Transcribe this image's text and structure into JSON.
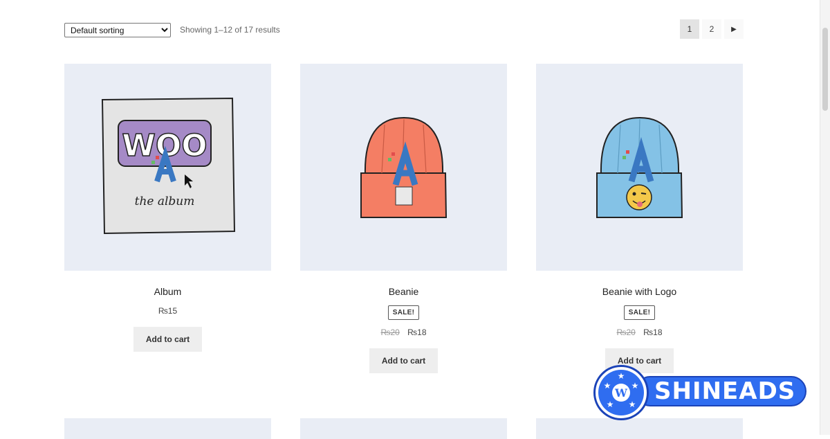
{
  "toolbar": {
    "sort_value": "Default sorting",
    "result_count": "Showing 1–12 of 17 results"
  },
  "pagination": {
    "pages": [
      "1",
      "2"
    ],
    "current": "1",
    "next_icon": "triangle-right-icon"
  },
  "products": [
    {
      "title": "Album",
      "sale_badge": "",
      "old_price": "",
      "price": "₨15",
      "button": "Add to cart",
      "image": "woo-album-art"
    },
    {
      "title": "Beanie",
      "sale_badge": "SALE!",
      "old_price": "₨20",
      "price": "₨18",
      "button": "Add to cart",
      "image": "orange-beanie"
    },
    {
      "title": "Beanie with Logo",
      "sale_badge": "SALE!",
      "old_price": "₨20",
      "price": "₨18",
      "button": "Add to cart",
      "image": "blue-beanie-with-logo"
    }
  ],
  "album_art": {
    "logo_text": "WOO",
    "subtitle": "the album"
  },
  "watermark": {
    "text": "SHINEADS"
  },
  "colors": {
    "thumb_bg": "#e9edf5",
    "orange_beanie": "#f47e64",
    "blue_beanie": "#84c2e6",
    "woo_purple": "#a58ac6",
    "brand_blue": "#2f6df0"
  }
}
